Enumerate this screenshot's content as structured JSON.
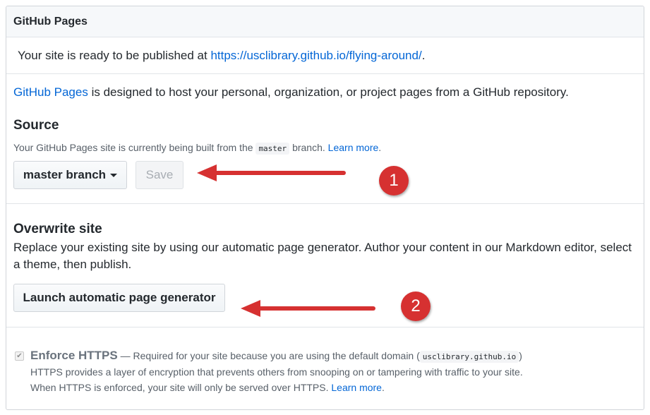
{
  "header": {
    "title": "GitHub Pages"
  },
  "status": {
    "text": "Your site is ready to be published at ",
    "url": "https://usclibrary.github.io/flying-around/",
    "suffix": "."
  },
  "intro": {
    "link": "GitHub Pages",
    "text": " is designed to host your personal, organization, or project pages from a GitHub repository."
  },
  "source": {
    "heading": "Source",
    "note_prefix": "Your GitHub Pages site is currently being built from the ",
    "branch_code": "master",
    "note_suffix": " branch. ",
    "learn_more": "Learn more",
    "learn_more_suffix": ".",
    "branch_button": "master branch",
    "save_button": "Save"
  },
  "overwrite": {
    "heading": "Overwrite site",
    "description": "Replace your existing site by using our automatic page generator. Author your content in our Markdown editor, select a theme, then publish.",
    "button": "Launch automatic page generator"
  },
  "https": {
    "title": "Enforce HTTPS",
    "dash_text": " — Required for your site because you are using the default domain (",
    "domain_code": "usclibrary.github.io",
    "close_paren": ")",
    "line2": "HTTPS provides a layer of encryption that prevents others from snooping on or tampering with traffic to your site.",
    "line3_prefix": "When HTTPS is enforced, your site will only be served over HTTPS. ",
    "learn_more": "Learn more",
    "learn_more_suffix": ".",
    "checked": true
  },
  "annotations": {
    "badge1": "1",
    "badge2": "2",
    "color": "#d63131"
  },
  "colors": {
    "link": "#0366d6",
    "header_bg": "#f6f8fa",
    "border": "#e1e4e8"
  }
}
